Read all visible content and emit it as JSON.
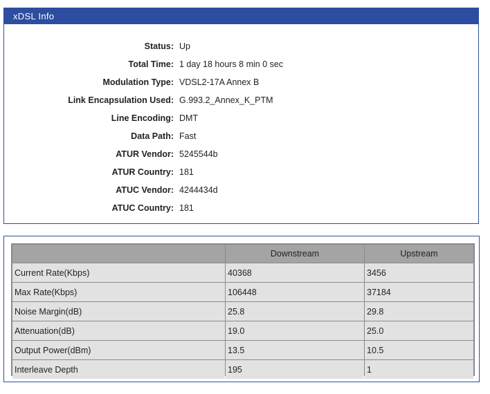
{
  "panel_title": "xDSL Info",
  "info": [
    {
      "label": "Status:",
      "value": "Up"
    },
    {
      "label": "Total Time:",
      "value": "1 day 18 hours 8 min 0 sec"
    },
    {
      "label": "Modulation Type:",
      "value": "VDSL2-17A Annex B"
    },
    {
      "label": "Link Encapsulation Used:",
      "value": "G.993.2_Annex_K_PTM"
    },
    {
      "label": "Line Encoding:",
      "value": "DMT"
    },
    {
      "label": "Data Path:",
      "value": "Fast"
    },
    {
      "label": "ATUR Vendor:",
      "value": "5245544b"
    },
    {
      "label": "ATUR Country:",
      "value": "181"
    },
    {
      "label": "ATUC Vendor:",
      "value": "4244434d"
    },
    {
      "label": "ATUC Country:",
      "value": "181"
    }
  ],
  "stats": {
    "headers": [
      "",
      "Downstream",
      "Upstream"
    ],
    "rows": [
      [
        "Current Rate(Kbps)",
        "40368",
        "3456"
      ],
      [
        "Max Rate(Kbps)",
        "106448",
        "37184"
      ],
      [
        "Noise Margin(dB)",
        "25.8",
        "29.8"
      ],
      [
        "Attenuation(dB)",
        "19.0",
        "25.0"
      ],
      [
        "Output Power(dBm)",
        "13.5",
        "10.5"
      ],
      [
        "Interleave Depth",
        "195",
        "1"
      ]
    ]
  },
  "colors": {
    "header_bg": "#2c4da0",
    "border": "#2d4e9a",
    "th_bg": "#a4a4a4",
    "td_bg": "#e2e2e2"
  }
}
